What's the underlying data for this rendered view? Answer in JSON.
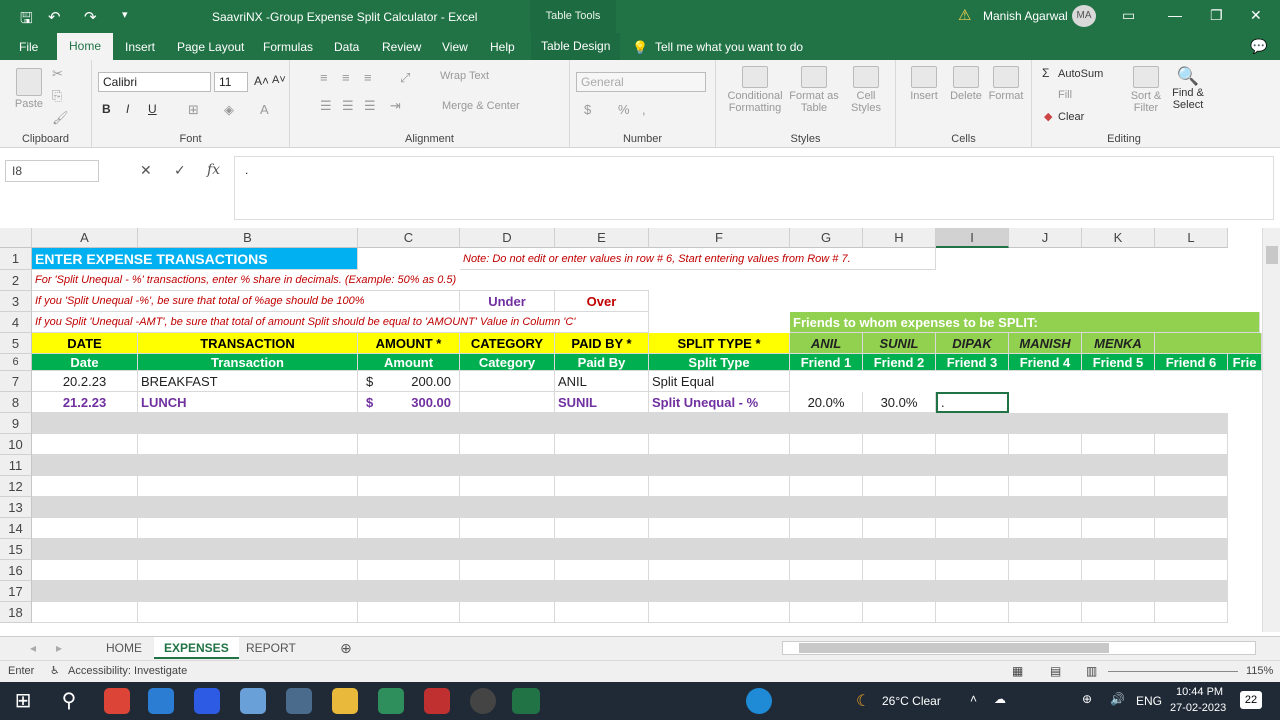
{
  "window": {
    "title": "SaavriNX -Group Expense Split Calculator  -  Excel",
    "table_tools": "Table Tools",
    "user": "Manish Agarwal",
    "avatar": "MA"
  },
  "tabs": [
    "File",
    "Home",
    "Insert",
    "Page Layout",
    "Formulas",
    "Data",
    "Review",
    "View",
    "Help",
    "Table Design"
  ],
  "tellme": "Tell me what you want to do",
  "ribbon": {
    "clipboard": {
      "label": "Clipboard",
      "paste": "Paste"
    },
    "font": {
      "label": "Font",
      "name": "Calibri",
      "size": "11"
    },
    "alignment": {
      "label": "Alignment",
      "wrap": "Wrap Text",
      "merge": "Merge & Center"
    },
    "number": {
      "label": "Number",
      "format": "General"
    },
    "styles": {
      "label": "Styles",
      "cond": "Conditional Formatting",
      "table": "Format as Table",
      "cell": "Cell Styles"
    },
    "cells": {
      "label": "Cells",
      "insert": "Insert",
      "delete": "Delete",
      "format": "Format"
    },
    "editing": {
      "label": "Editing",
      "autosum": "AutoSum",
      "fill": "Fill",
      "clear": "Clear",
      "sort": "Sort & Filter",
      "find": "Find & Select"
    }
  },
  "formula_bar": {
    "namebox": "I8",
    "content": "."
  },
  "columns": [
    "A",
    "B",
    "C",
    "D",
    "E",
    "F",
    "G",
    "H",
    "I",
    "J",
    "K",
    "L"
  ],
  "rows": [
    "1",
    "2",
    "3",
    "4",
    "5",
    "6",
    "7",
    "8",
    "9",
    "10",
    "11",
    "12",
    "13",
    "14",
    "15",
    "16",
    "17",
    "18"
  ],
  "sheet": {
    "a1": "ENTER EXPENSE TRANSACTIONS",
    "note": "Note: Do not edit or enter values in row # 6, Start entering values from Row # 7.",
    "r2": "For 'Split Unequal - %' transactions, enter % share in decimals. (Example: 50% as 0.5)",
    "r3": "If you 'Split Unequal -%', be sure that total of %age should be 100%",
    "under": "Under",
    "over": "Over",
    "r4": "If you Split 'Unequal -AMT', be sure that total of amount Split should be equal to 'AMOUNT' Value in Column 'C'",
    "friends_label": "Friends to whom expenses to be SPLIT:",
    "headers5": [
      "DATE",
      "TRANSACTION",
      "AMOUNT *",
      "CATEGORY",
      "PAID BY *",
      "SPLIT TYPE *",
      "ANIL",
      "SUNIL",
      "DIPAK",
      "MANISH",
      "MENKA"
    ],
    "headers6": [
      "Date",
      "Transaction",
      "Amount",
      "Category",
      "Paid By",
      "Split Type",
      "Friend 1",
      "Friend 2",
      "Friend 3",
      "Friend 4",
      "Friend 5",
      "Friend 6",
      "Frie"
    ],
    "row7": {
      "date": "20.2.23",
      "txn": "BREAKFAST",
      "cur": "$",
      "amt": "200.00",
      "paid": "ANIL",
      "split": "Split Equal"
    },
    "row8": {
      "date": "21.2.23",
      "txn": "LUNCH",
      "cur": "$",
      "amt": "300.00",
      "paid": "SUNIL",
      "split": "Split Unequal - %",
      "g": "20.0%",
      "h": "30.0%",
      "i": "."
    }
  },
  "sheet_tabs": [
    "HOME",
    "EXPENSES",
    "REPORT"
  ],
  "status": {
    "mode": "Enter",
    "accessibility": "Accessibility: Investigate",
    "zoom": "115%"
  },
  "taskbar": {
    "weather": "26°C  Clear",
    "lang": "ENG",
    "time": "10:44 PM",
    "date": "27-02-2023",
    "badge": "22"
  },
  "colors": {
    "excel_green": "#217346",
    "header_yellow": "#ffff00",
    "friends_green": "#92d050",
    "title_blue": "#00b0f0",
    "row6_green": "#00b050",
    "note_red": "#c00000",
    "purple": "#7030a0"
  }
}
